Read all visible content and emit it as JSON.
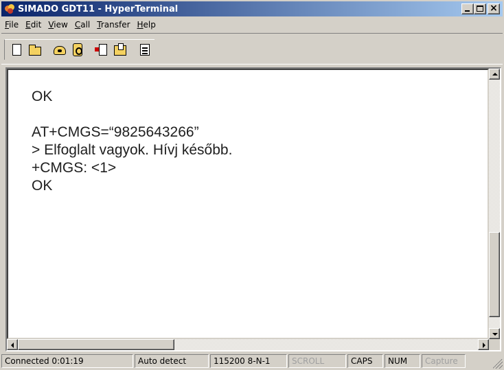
{
  "window": {
    "title": "SIMADO GDT11 - HyperTerminal"
  },
  "menu": [
    {
      "label": "File",
      "key": "F",
      "rest": "ile"
    },
    {
      "label": "Edit",
      "key": "E",
      "rest": "dit"
    },
    {
      "label": "View",
      "key": "V",
      "rest": "iew"
    },
    {
      "label": "Call",
      "key": "C",
      "rest": "all"
    },
    {
      "label": "Transfer",
      "key": "T",
      "rest": "ransfer"
    },
    {
      "label": "Help",
      "key": "H",
      "rest": "elp"
    }
  ],
  "toolbar": {
    "icons": [
      "new-icon",
      "open-icon",
      "call-icon",
      "disconnect-icon",
      "send-icon",
      "receive-icon",
      "properties-icon"
    ]
  },
  "terminal": {
    "lines": [
      "OK",
      "",
      "AT+CMGS=“9825643266”",
      "> Elfoglalt vagyok. Hívj később.",
      "+CMGS: <1>",
      "OK"
    ]
  },
  "status": {
    "connected": "Connected 0:01:19",
    "detect": "Auto detect",
    "port": "115200 8-N-1",
    "scroll": "SCROLL",
    "caps": "CAPS",
    "num": "NUM",
    "capture": "Capture"
  },
  "colors": {
    "titlebar_start": "#0a246a",
    "titlebar_end": "#a6caf0",
    "face": "#d4d0c8",
    "terminal_bg": "#ffffff",
    "terminal_text": "#202020"
  }
}
